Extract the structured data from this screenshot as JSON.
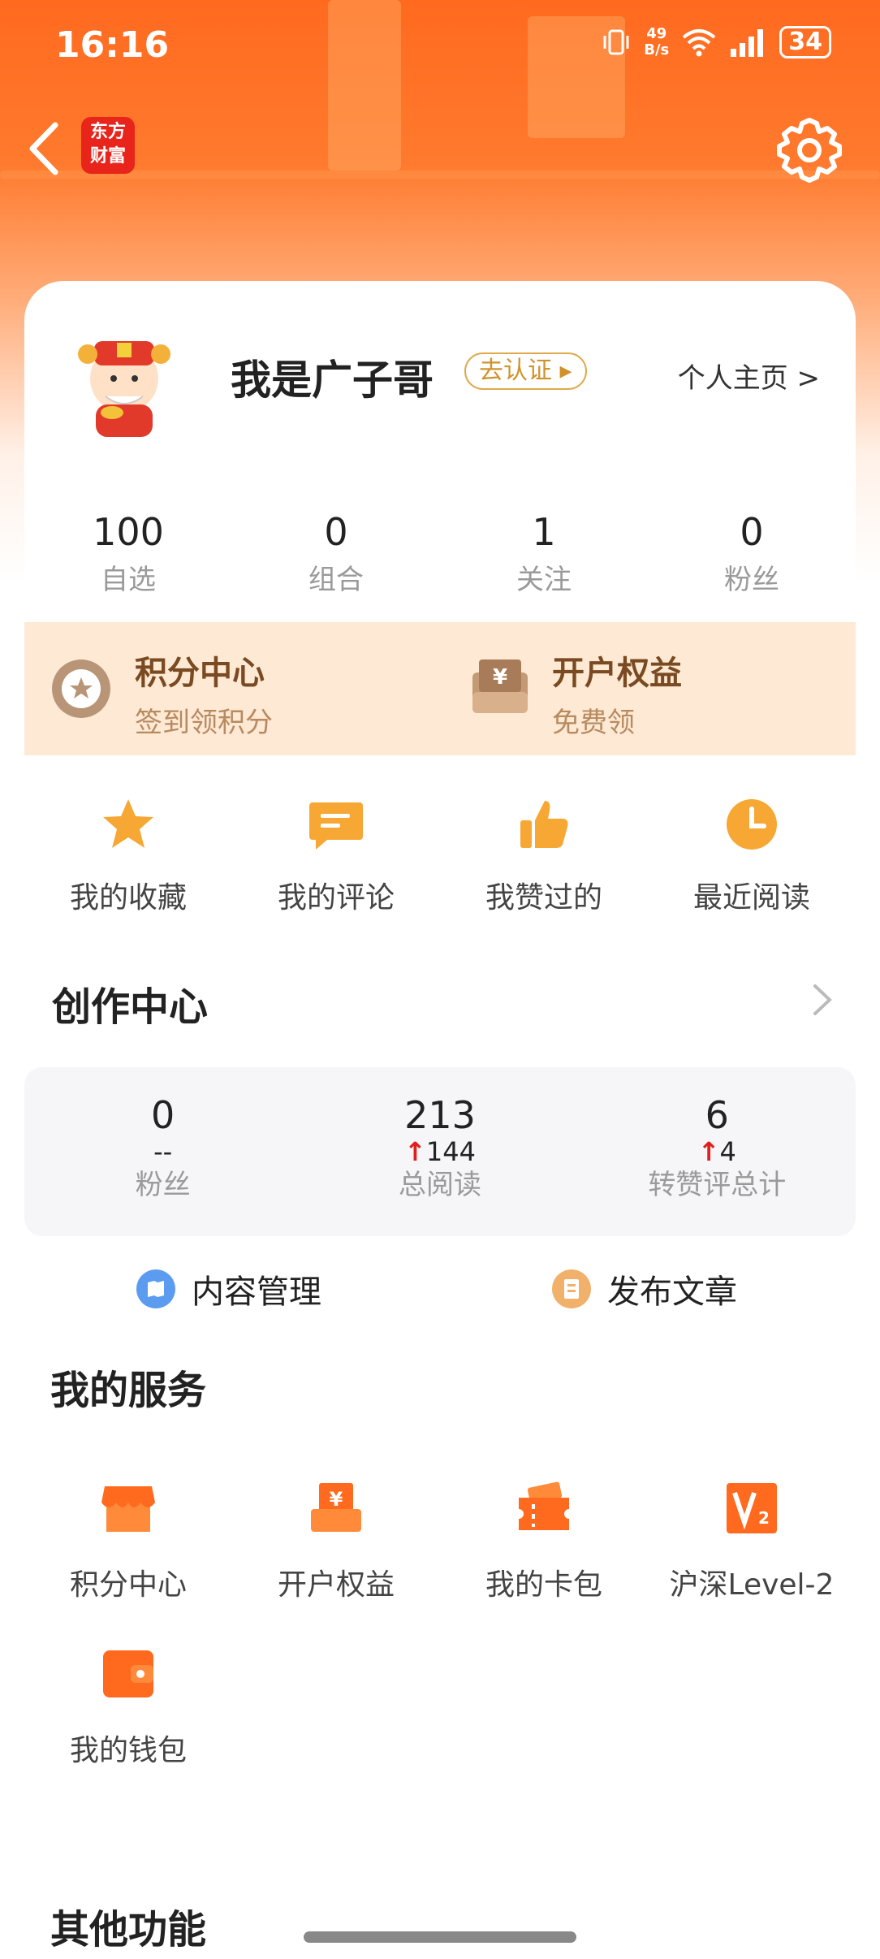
{
  "status": {
    "time": "16:16",
    "net_speed_top": "49",
    "net_speed_bottom": "B/s",
    "battery": "34"
  },
  "nav": {
    "logo_top": "东方",
    "logo_bottom": "财富",
    "back_icon": "back-chevron-icon",
    "settings_icon": "gear-icon"
  },
  "profile": {
    "name": "我是广子哥",
    "verify_label": "去认证 ▸",
    "homepage_label": "个人主页 >",
    "stats": [
      {
        "value": "100",
        "label": "自选"
      },
      {
        "value": "0",
        "label": "组合"
      },
      {
        "value": "1",
        "label": "关注"
      },
      {
        "value": "0",
        "label": "粉丝"
      }
    ]
  },
  "benefits": [
    {
      "title": "积分中心",
      "subtitle": "签到领积分",
      "icon": "star-badge-icon"
    },
    {
      "title": "开户权益",
      "subtitle": "免费领",
      "icon": "yuan-box-icon"
    }
  ],
  "quick_links": [
    {
      "label": "我的收藏",
      "icon": "star-icon"
    },
    {
      "label": "我的评论",
      "icon": "comment-icon"
    },
    {
      "label": "我赞过的",
      "icon": "thumbs-up-icon"
    },
    {
      "label": "最近阅读",
      "icon": "clock-icon"
    }
  ],
  "creator": {
    "title": "创作中心",
    "stats": [
      {
        "value": "0",
        "delta": "--",
        "label": "粉丝",
        "up": false
      },
      {
        "value": "213",
        "delta": "144",
        "label": "总阅读",
        "up": true
      },
      {
        "value": "6",
        "delta": "4",
        "label": "转赞评总计",
        "up": true
      }
    ],
    "actions": [
      {
        "label": "内容管理",
        "icon": "content-manage-icon",
        "color": "#5b9cf0"
      },
      {
        "label": "发布文章",
        "icon": "publish-article-icon",
        "color": "#f2b16a"
      }
    ]
  },
  "services": {
    "title": "我的服务",
    "items": [
      {
        "label": "积分中心",
        "icon": "store-icon"
      },
      {
        "label": "开户权益",
        "icon": "yuan-box-icon"
      },
      {
        "label": "我的卡包",
        "icon": "ticket-icon"
      },
      {
        "label": "沪深Level-2",
        "icon": "level2-icon"
      },
      {
        "label": "我的钱包",
        "icon": "wallet-icon"
      }
    ]
  },
  "other": {
    "title": "其他功能"
  },
  "colors": {
    "accent": "#ff6a1f",
    "up_red": "#e02020",
    "gold": "#d0922b"
  }
}
